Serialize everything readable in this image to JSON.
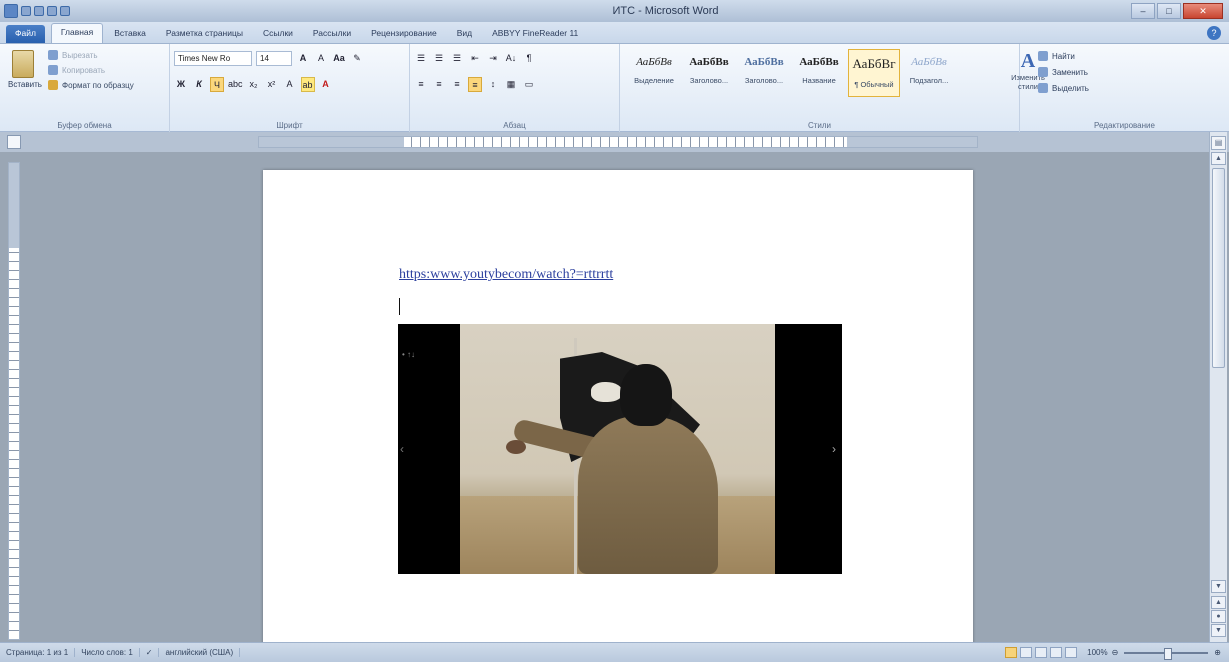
{
  "window": {
    "title": "ИТС - Microsoft Word",
    "minimize": "–",
    "maximize": "□",
    "close": "✕"
  },
  "tabs": [
    "Файл",
    "Главная",
    "Вставка",
    "Разметка страницы",
    "Ссылки",
    "Рассылки",
    "Рецензирование",
    "Вид",
    "ABBYY FineReader 11"
  ],
  "ribbon": {
    "clipboard": {
      "paste": "Вставить",
      "cut": "Вырезать",
      "copy": "Копировать",
      "format_painter": "Формат по образцу",
      "label": "Буфер обмена"
    },
    "font": {
      "name": "Times New Ro",
      "size": "14",
      "label": "Шрифт",
      "tools_row1": [
        "A",
        "A",
        "Aa",
        "✎"
      ],
      "tools_row2": [
        "Ж",
        "К",
        "Ч",
        "abc",
        "x₂",
        "x²",
        "A",
        "ab",
        "A"
      ]
    },
    "paragraph": {
      "label": "Абзац",
      "tools_row1": [
        "☰",
        "☰",
        "☰",
        "⇤",
        "⇥",
        "A↓",
        "¶"
      ],
      "tools_row2": [
        "≡",
        "≡",
        "≡",
        "≡",
        "↕",
        "▦",
        "▭"
      ]
    },
    "styles": {
      "label": "Стили",
      "items": [
        {
          "sample": "АаБбВв",
          "name": "Выделение"
        },
        {
          "sample": "АаБбВв",
          "name": "Заголово..."
        },
        {
          "sample": "АаБбВв",
          "name": "Заголово..."
        },
        {
          "sample": "АаБбВв",
          "name": "Название"
        },
        {
          "sample": "АаБбВг",
          "name": "¶ Обычный"
        },
        {
          "sample": "АаБбВв",
          "name": "Подзагол..."
        }
      ],
      "change_styles": "Изменить стили"
    },
    "editing": {
      "label": "Редактирование",
      "find": "Найти",
      "replace": "Заменить",
      "select": "Выделить"
    }
  },
  "document": {
    "link_text": "https:www.youtybecom/watch?=rttrrtt"
  },
  "statusbar": {
    "page": "Страница: 1 из 1",
    "words": "Число слов: 1",
    "language": "английский (США)",
    "zoom": "100%"
  }
}
